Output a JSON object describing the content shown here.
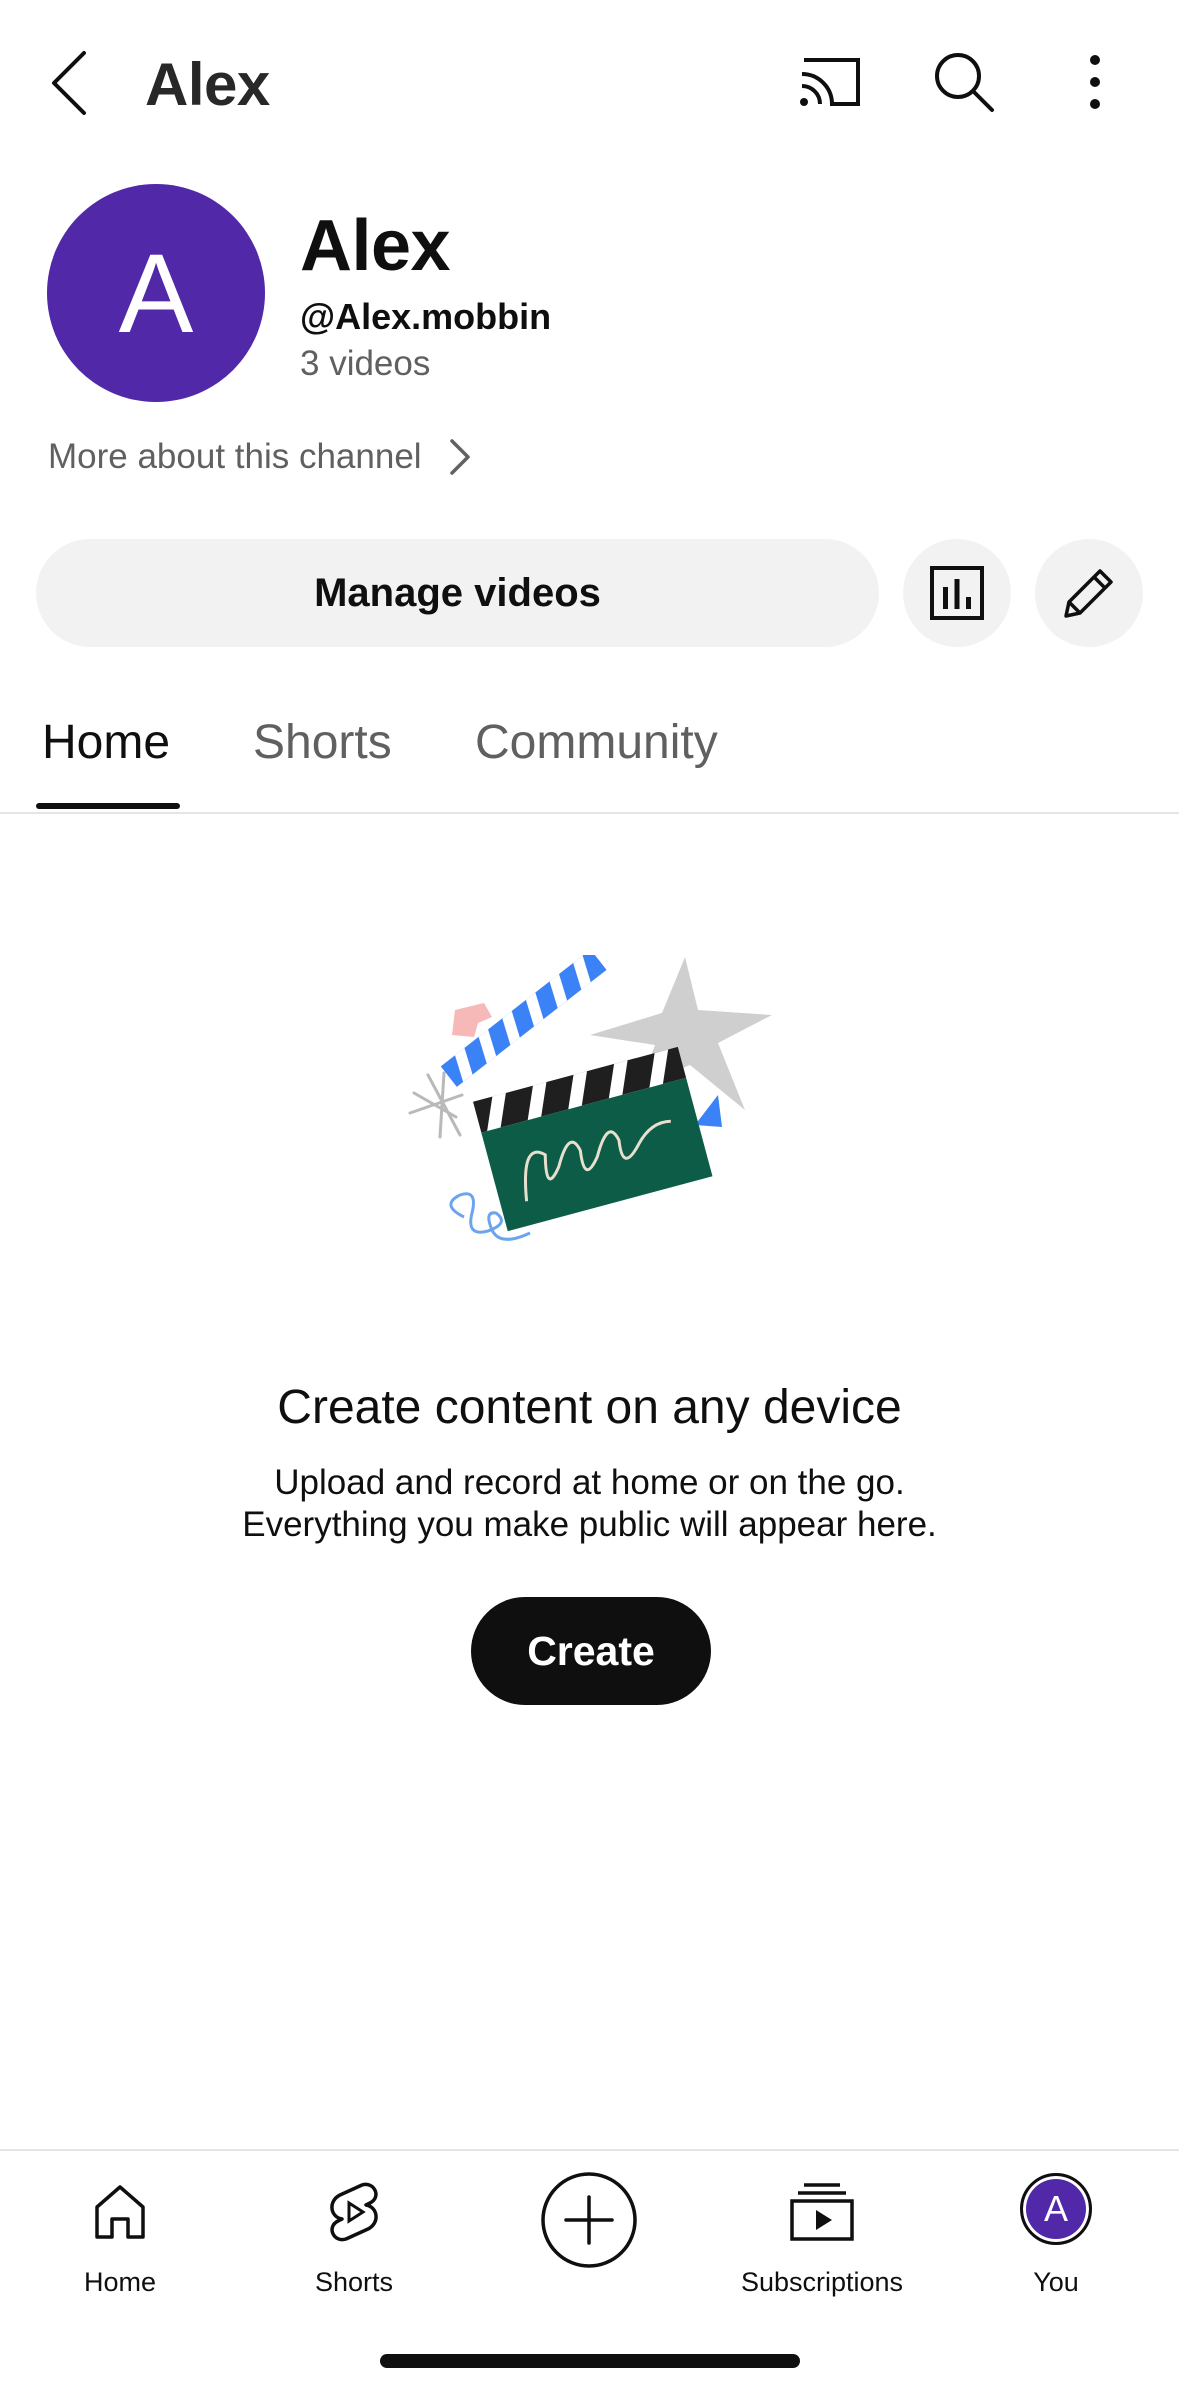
{
  "topbar": {
    "title": "Alex",
    "icons": [
      "chevron-left-icon",
      "cast-icon",
      "search-icon",
      "more-vertical-icon"
    ]
  },
  "channel": {
    "avatar_letter": "A",
    "avatar_color": "#5128a7",
    "name": "Alex",
    "handle": "@Alex.mobbin",
    "video_count": "3 videos",
    "more_about": "More about this channel"
  },
  "actions": {
    "manage_videos": "Manage videos",
    "icons": [
      "analytics-icon",
      "edit-pencil-icon"
    ]
  },
  "tabs": [
    {
      "label": "Home",
      "active": true
    },
    {
      "label": "Shorts",
      "active": false
    },
    {
      "label": "Community",
      "active": false
    }
  ],
  "empty_state": {
    "title": "Create content on any device",
    "description_line1": "Upload and record at home or on the go.",
    "description_line2": "Everything you make public will appear here.",
    "create_button": "Create",
    "illustration": "clapperboard-illustration-icon"
  },
  "bottom_nav": {
    "items": [
      {
        "label": "Home",
        "icon": "home-icon"
      },
      {
        "label": "Shorts",
        "icon": "shorts-icon"
      },
      {
        "label": "",
        "icon": "add-circle-icon"
      },
      {
        "label": "Subscriptions",
        "icon": "subscriptions-icon"
      },
      {
        "label": "You",
        "icon": "avatar",
        "avatar_letter": "A"
      }
    ]
  },
  "colors": {
    "accent": "#5128a7",
    "text_primary": "#0f0f0f",
    "text_secondary": "#606060",
    "button_bg": "#f2f2f2"
  }
}
